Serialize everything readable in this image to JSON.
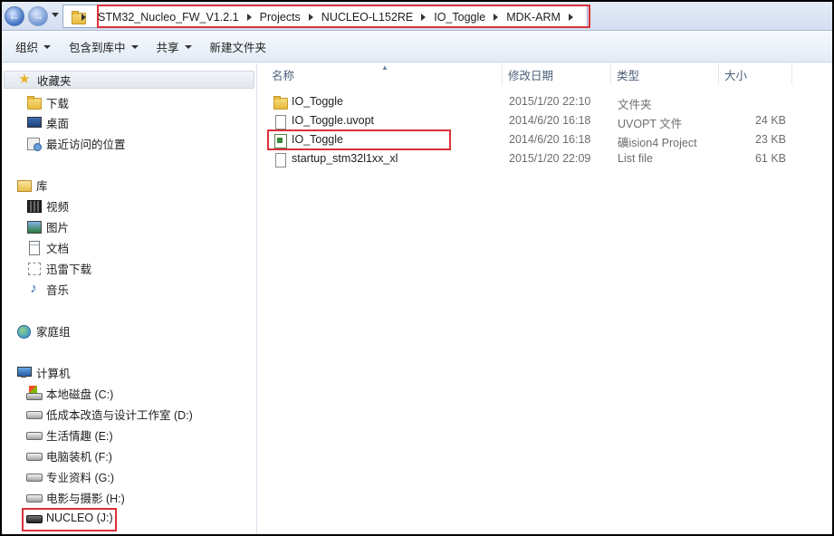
{
  "address": {
    "crumbs": [
      "STM32_Nucleo_FW_V1.2.1",
      "Projects",
      "NUCLEO-L152RE",
      "IO_Toggle",
      "MDK-ARM"
    ]
  },
  "toolbar": {
    "organize": "组织",
    "include_library": "包含到库中",
    "share": "共享",
    "new_folder": "新建文件夹"
  },
  "nav": {
    "favorites": "收藏夹",
    "downloads": "下载",
    "desktop": "桌面",
    "recent": "最近访问的位置",
    "libraries": "库",
    "videos": "视频",
    "pictures": "图片",
    "documents": "文档",
    "xunlei": "迅雷下载",
    "music": "音乐",
    "homegroup": "家庭组",
    "computer": "计算机",
    "drives": [
      "本地磁盘 (C:)",
      "低成本改造与设计工作室 (D:)",
      "生活情趣 (E:)",
      "电脑装机 (F:)",
      "专业资料 (G:)",
      "电影与摄影 (H:)",
      "NUCLEO (J:)"
    ]
  },
  "columns": {
    "name": "名称",
    "date": "修改日期",
    "type": "类型",
    "size": "大小"
  },
  "files": [
    {
      "name": "IO_Toggle",
      "date": "2015/1/20 22:10",
      "type": "文件夹",
      "size": "",
      "icon": "folder-icon"
    },
    {
      "name": "IO_Toggle.uvopt",
      "date": "2014/6/20 16:18",
      "type": "UVOPT 文件",
      "size": "24 KB",
      "icon": "document-icon"
    },
    {
      "name": "IO_Toggle",
      "date": "2014/6/20 16:18",
      "type": "礦ision4 Project",
      "size": "23 KB",
      "icon": "uvision-project-icon"
    },
    {
      "name": "startup_stm32l1xx_xl",
      "date": "2015/1/20 22:09",
      "type": "List file",
      "size": "61 KB",
      "icon": "document-icon"
    }
  ],
  "colors": {
    "highlight": "#d9323a",
    "selection": "#e2e7ee"
  }
}
